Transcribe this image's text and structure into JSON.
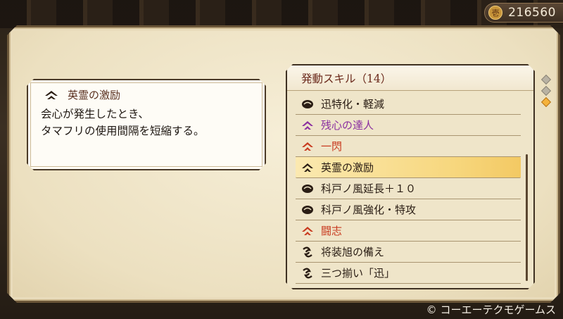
{
  "money": {
    "icon": "coin-icon",
    "amount": "216560"
  },
  "description": {
    "skill_name": "英霊の激励",
    "icon": "chevron-skill-icon",
    "text": "会心が発生したとき、\nタマフリの使用間隔を短縮する。"
  },
  "skill_list": {
    "header": "発動スキル（14）",
    "items": [
      {
        "label": "迅特化・軽減",
        "icon": "magatama-icon",
        "color": "#2a1d14"
      },
      {
        "label": "残心の達人",
        "icon": "chevron-skill-icon",
        "color": "#8a2fa0"
      },
      {
        "label": "一閃",
        "icon": "chevron-skill-icon",
        "color": "#c83a1f"
      },
      {
        "label": "英霊の激励",
        "icon": "chevron-skill-icon",
        "color": "#2a1d14",
        "selected": true
      },
      {
        "label": "科戸ノ風延長＋１０",
        "icon": "magatama-icon",
        "color": "#2a1d14"
      },
      {
        "label": "科戸ノ風強化・特攻",
        "icon": "magatama-icon",
        "color": "#2a1d14"
      },
      {
        "label": "闘志",
        "icon": "chevron-skill-icon",
        "color": "#c83a1f"
      },
      {
        "label": "将装旭の備え",
        "icon": "swirl-icon",
        "color": "#2a1d14"
      },
      {
        "label": "三つ揃い「迅」",
        "icon": "swirl-icon",
        "color": "#2a1d14"
      }
    ]
  },
  "copyright": "© コーエーテクモゲームス"
}
